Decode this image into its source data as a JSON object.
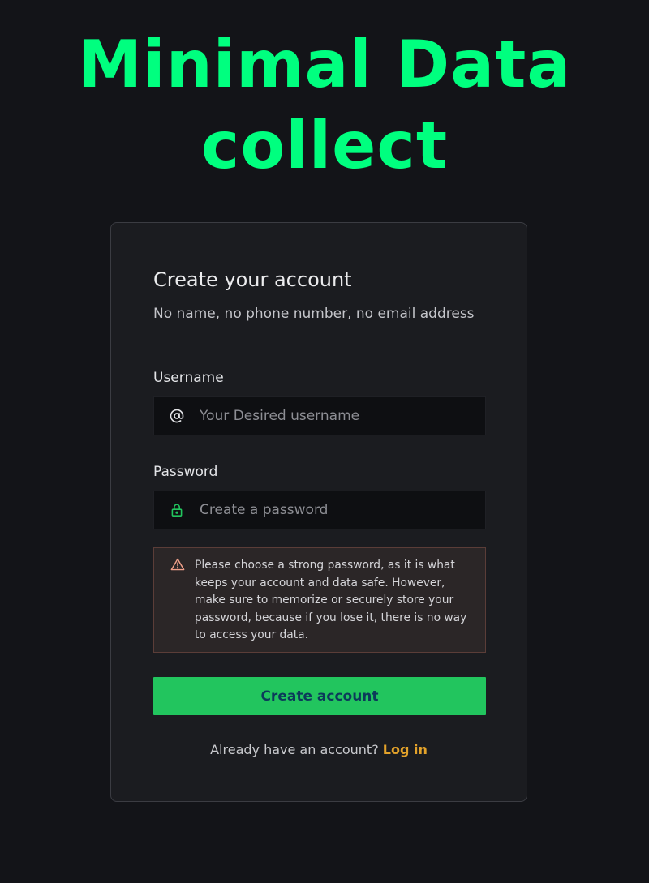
{
  "headline": {
    "line1": "Minimal Data",
    "line2": "collect"
  },
  "form": {
    "title": "Create your account",
    "subtitle": "No name, no phone number, no email address",
    "username": {
      "label": "Username",
      "placeholder": "Your Desired username",
      "value": "",
      "icon": "at-sign-icon"
    },
    "password": {
      "label": "Password",
      "placeholder": "Create a password",
      "value": "",
      "icon": "lock-icon"
    },
    "warning": {
      "icon": "warning-triangle-icon",
      "text": "Please choose a strong password, as it is what keeps your account and data safe. However, make sure to memorize or securely store your password, because if you lose it, there is no way to access your data."
    },
    "submit_label": "Create account",
    "footer": {
      "prompt": "Already have an account?",
      "login_label": "Log in"
    }
  },
  "colors": {
    "background": "#131418",
    "headline": "#00ff7f",
    "card": "#1b1c20",
    "primary_button": "#22c55e",
    "primary_button_text": "#0c3a5a",
    "link": "#e3a22a",
    "lock_icon": "#22c55e",
    "warning_icon": "#f0a08a"
  }
}
